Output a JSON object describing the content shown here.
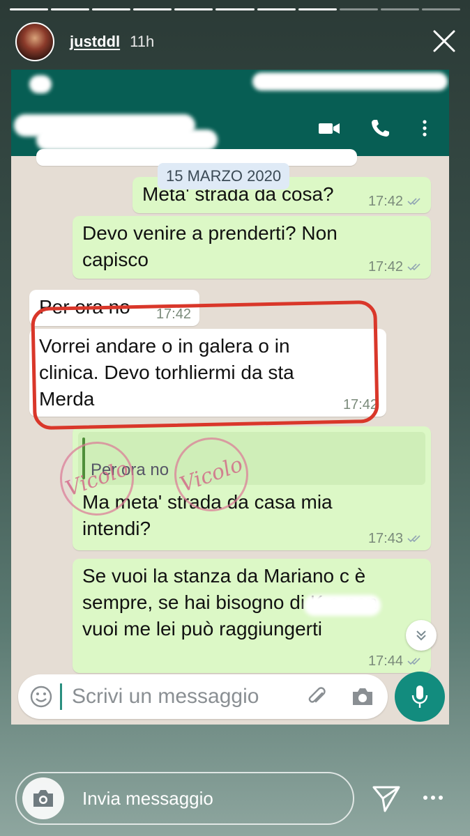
{
  "story": {
    "username": "justddl",
    "time": "11h",
    "reply_placeholder": "Invia messaggio"
  },
  "chat": {
    "date": "15 MARZO 2020",
    "messages": [
      {
        "direction": "out",
        "text": "Meta' strada da cosa?",
        "time": "17:42"
      },
      {
        "direction": "out",
        "text": "Devo venire a prenderti? Non capisco",
        "time": "17:42"
      },
      {
        "direction": "in",
        "text": "Per ora no",
        "time": "17:42"
      },
      {
        "direction": "in",
        "text": "Vorrei andare o in galera o in clinica. Devo torhliermi da sta Merda",
        "time": "17:42"
      },
      {
        "direction": "out",
        "quote": "Per ora no",
        "text": "Ma meta' strada da casa mia intendi?",
        "time": "17:43"
      },
      {
        "direction": "out",
        "text": "Se vuoi la stanza da Mariano c è sempre, se hai bisogno di K e non vuoi me lei può raggiungerti",
        "time": "17:44"
      }
    ],
    "composer_placeholder": "Scrivi un messaggio"
  },
  "watermark": "Vicolo",
  "colors": {
    "wa_green": "#075e54",
    "out_bubble": "#dcf8c6",
    "highlight": "#d9372a",
    "mic": "#128c7e"
  }
}
